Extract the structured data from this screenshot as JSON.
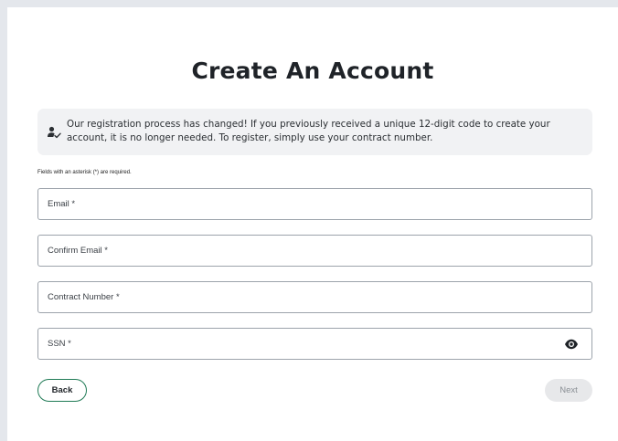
{
  "page": {
    "title": "Create An Account"
  },
  "notice": {
    "icon": "person-check-icon",
    "text": "Our registration process has changed! If you previously received a unique 12-digit code to create your account, it is no longer needed. To register, simply use your contract number."
  },
  "form": {
    "required_note": "Fields with an asterisk (*) are required.",
    "email_placeholder": "Email *",
    "confirm_email_placeholder": "Confirm Email *",
    "contract_placeholder": "Contract Number *",
    "ssn_placeholder": "SSN *",
    "ssn_toggle_icon": "eye-icon"
  },
  "actions": {
    "back_label": "Back",
    "next_label": "Next",
    "accent_color": "#1f7a55"
  }
}
